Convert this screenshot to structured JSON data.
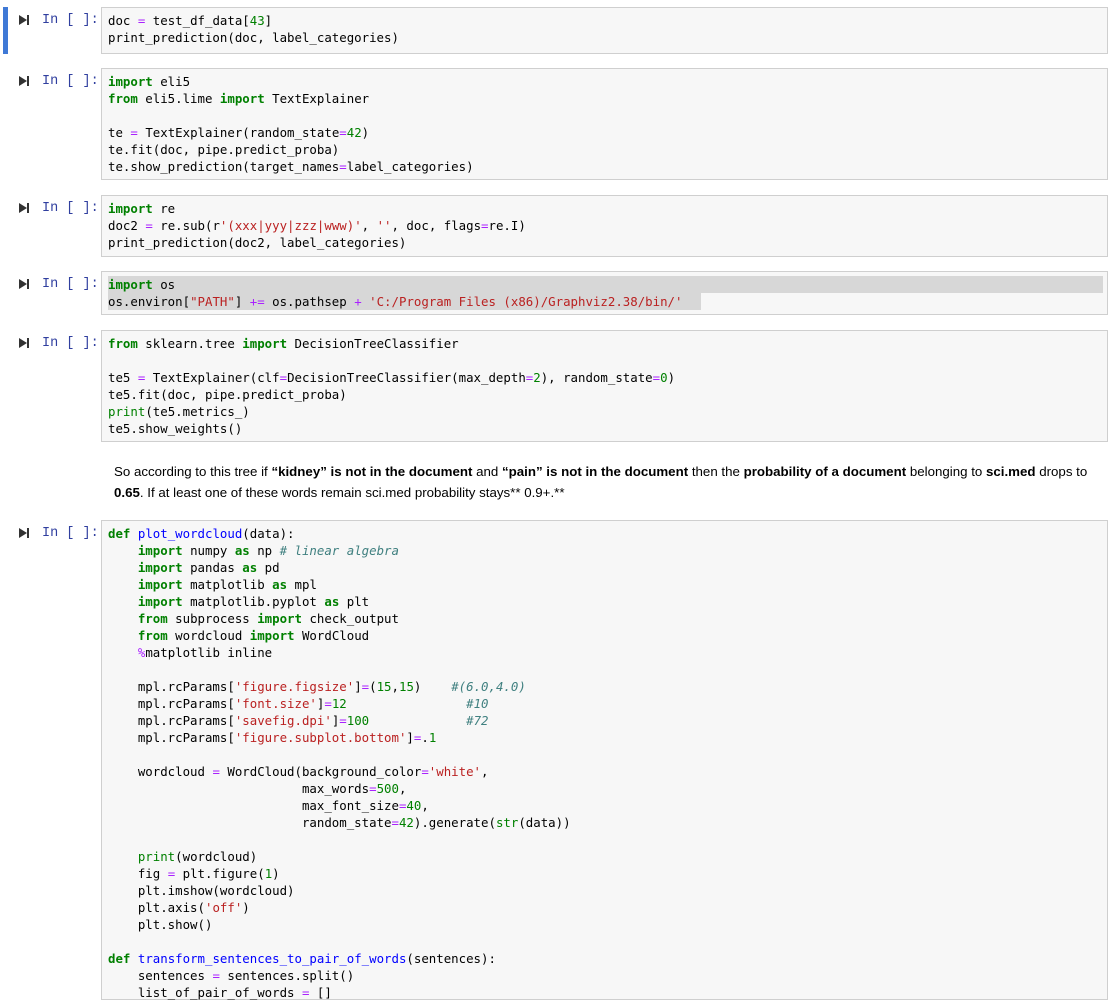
{
  "cells": [
    {
      "prompt": "In [ ]:",
      "lines": [
        [
          [
            "n",
            "doc "
          ],
          [
            "op",
            "="
          ],
          [
            "n",
            " test_df_data["
          ],
          [
            "nu",
            "43"
          ],
          [
            "n",
            "]"
          ]
        ],
        [
          [
            "n",
            "print_prediction(doc, label_categories)"
          ]
        ]
      ]
    },
    {
      "prompt": "In [ ]:",
      "lines": [
        [
          [
            "kw",
            "import"
          ],
          [
            "n",
            " eli5"
          ]
        ],
        [
          [
            "kw",
            "from"
          ],
          [
            "n",
            " eli5.lime "
          ],
          [
            "kw",
            "import"
          ],
          [
            "n",
            " TextExplainer"
          ]
        ],
        [
          [
            "n",
            ""
          ]
        ],
        [
          [
            "n",
            "te "
          ],
          [
            "op",
            "="
          ],
          [
            "n",
            " TextExplainer(random_state"
          ],
          [
            "op",
            "="
          ],
          [
            "nu",
            "42"
          ],
          [
            "n",
            ")"
          ]
        ],
        [
          [
            "n",
            "te.fit(doc, pipe.predict_proba)"
          ]
        ],
        [
          [
            "n",
            "te.show_prediction(target_names"
          ],
          [
            "op",
            "="
          ],
          [
            "n",
            "label_categories)"
          ]
        ]
      ]
    },
    {
      "prompt": "In [ ]:",
      "lines": [
        [
          [
            "kw",
            "import"
          ],
          [
            "n",
            " re"
          ]
        ],
        [
          [
            "n",
            "doc2 "
          ],
          [
            "op",
            "="
          ],
          [
            "n",
            " re.sub(r"
          ],
          [
            "st",
            "'(xxx|yyy|zzz|www)'"
          ],
          [
            "n",
            ", "
          ],
          [
            "st",
            "''"
          ],
          [
            "n",
            ", doc, flags"
          ],
          [
            "op",
            "="
          ],
          [
            "n",
            "re.I)"
          ]
        ],
        [
          [
            "n",
            "print_prediction(doc2, label_categories)"
          ]
        ]
      ]
    },
    {
      "prompt": "In [ ]:",
      "lines": [
        [
          [
            "kw",
            "import"
          ],
          [
            "n",
            " os"
          ]
        ],
        [
          [
            "n",
            "os.environ["
          ],
          [
            "st",
            "\"PATH\""
          ],
          [
            "n",
            "] "
          ],
          [
            "op",
            "+="
          ],
          [
            "n",
            " os.pathsep "
          ],
          [
            "op",
            "+"
          ],
          [
            "n",
            " "
          ],
          [
            "st",
            "'C:/Program Files (x86)/Graphviz2.38/bin/'"
          ]
        ]
      ]
    },
    {
      "prompt": "In [ ]:",
      "lines": [
        [
          [
            "kw",
            "from"
          ],
          [
            "n",
            " sklearn.tree "
          ],
          [
            "kw",
            "import"
          ],
          [
            "n",
            " DecisionTreeClassifier"
          ]
        ],
        [
          [
            "n",
            ""
          ]
        ],
        [
          [
            "n",
            "te5 "
          ],
          [
            "op",
            "="
          ],
          [
            "n",
            " TextExplainer(clf"
          ],
          [
            "op",
            "="
          ],
          [
            "n",
            "DecisionTreeClassifier(max_depth"
          ],
          [
            "op",
            "="
          ],
          [
            "nu",
            "2"
          ],
          [
            "n",
            "), random_state"
          ],
          [
            "op",
            "="
          ],
          [
            "nu",
            "0"
          ],
          [
            "n",
            ")"
          ]
        ],
        [
          [
            "n",
            "te5.fit(doc, pipe.predict_proba)"
          ]
        ],
        [
          [
            "bi",
            "print"
          ],
          [
            "n",
            "(te5.metrics_)"
          ]
        ],
        [
          [
            "n",
            "te5.show_weights()"
          ]
        ]
      ]
    },
    {
      "prompt": "In [ ]:",
      "lines": [
        [
          [
            "kw",
            "def"
          ],
          [
            "n",
            " "
          ],
          [
            "fn",
            "plot_wordcloud"
          ],
          [
            "n",
            "(data):"
          ]
        ],
        [
          [
            "n",
            "    "
          ],
          [
            "kw",
            "import"
          ],
          [
            "n",
            " numpy "
          ],
          [
            "kw",
            "as"
          ],
          [
            "n",
            " np "
          ],
          [
            "cm",
            "# linear algebra"
          ]
        ],
        [
          [
            "n",
            "    "
          ],
          [
            "kw",
            "import"
          ],
          [
            "n",
            " pandas "
          ],
          [
            "kw",
            "as"
          ],
          [
            "n",
            " pd"
          ]
        ],
        [
          [
            "n",
            "    "
          ],
          [
            "kw",
            "import"
          ],
          [
            "n",
            " matplotlib "
          ],
          [
            "kw",
            "as"
          ],
          [
            "n",
            " mpl"
          ]
        ],
        [
          [
            "n",
            "    "
          ],
          [
            "kw",
            "import"
          ],
          [
            "n",
            " matplotlib.pyplot "
          ],
          [
            "kw",
            "as"
          ],
          [
            "n",
            " plt"
          ]
        ],
        [
          [
            "n",
            "    "
          ],
          [
            "kw",
            "from"
          ],
          [
            "n",
            " subprocess "
          ],
          [
            "kw",
            "import"
          ],
          [
            "n",
            " check_output"
          ]
        ],
        [
          [
            "n",
            "    "
          ],
          [
            "kw",
            "from"
          ],
          [
            "n",
            " wordcloud "
          ],
          [
            "kw",
            "import"
          ],
          [
            "n",
            " WordCloud"
          ]
        ],
        [
          [
            "n",
            "    "
          ],
          [
            "mg",
            "%"
          ],
          [
            "n",
            "matplotlib inline"
          ]
        ],
        [
          [
            "n",
            ""
          ]
        ],
        [
          [
            "n",
            "    mpl.rcParams["
          ],
          [
            "st",
            "'figure.figsize'"
          ],
          [
            "n",
            "]"
          ],
          [
            "op",
            "="
          ],
          [
            "n",
            "("
          ],
          [
            "nu",
            "15"
          ],
          [
            "n",
            ","
          ],
          [
            "nu",
            "15"
          ],
          [
            "n",
            ")    "
          ],
          [
            "cm",
            "#(6.0,4.0)"
          ]
        ],
        [
          [
            "n",
            "    mpl.rcParams["
          ],
          [
            "st",
            "'font.size'"
          ],
          [
            "n",
            "]"
          ],
          [
            "op",
            "="
          ],
          [
            "nu",
            "12"
          ],
          [
            "n",
            "                "
          ],
          [
            "cm",
            "#10"
          ]
        ],
        [
          [
            "n",
            "    mpl.rcParams["
          ],
          [
            "st",
            "'savefig.dpi'"
          ],
          [
            "n",
            "]"
          ],
          [
            "op",
            "="
          ],
          [
            "nu",
            "100"
          ],
          [
            "n",
            "             "
          ],
          [
            "cm",
            "#72"
          ]
        ],
        [
          [
            "n",
            "    mpl.rcParams["
          ],
          [
            "st",
            "'figure.subplot.bottom'"
          ],
          [
            "n",
            "]"
          ],
          [
            "op",
            "="
          ],
          [
            "n",
            "."
          ],
          [
            "nu",
            "1"
          ]
        ],
        [
          [
            "n",
            ""
          ]
        ],
        [
          [
            "n",
            "    wordcloud "
          ],
          [
            "op",
            "="
          ],
          [
            "n",
            " WordCloud(background_color"
          ],
          [
            "op",
            "="
          ],
          [
            "st",
            "'white'"
          ],
          [
            "n",
            ","
          ]
        ],
        [
          [
            "n",
            "                          max_words"
          ],
          [
            "op",
            "="
          ],
          [
            "nu",
            "500"
          ],
          [
            "n",
            ","
          ]
        ],
        [
          [
            "n",
            "                          max_font_size"
          ],
          [
            "op",
            "="
          ],
          [
            "nu",
            "40"
          ],
          [
            "n",
            ","
          ]
        ],
        [
          [
            "n",
            "                          random_state"
          ],
          [
            "op",
            "="
          ],
          [
            "nu",
            "42"
          ],
          [
            "n",
            ").generate("
          ],
          [
            "bi",
            "str"
          ],
          [
            "n",
            "(data))"
          ]
        ],
        [
          [
            "n",
            ""
          ]
        ],
        [
          [
            "n",
            "    "
          ],
          [
            "bi",
            "print"
          ],
          [
            "n",
            "(wordcloud)"
          ]
        ],
        [
          [
            "n",
            "    fig "
          ],
          [
            "op",
            "="
          ],
          [
            "n",
            " plt.figure("
          ],
          [
            "nu",
            "1"
          ],
          [
            "n",
            ")"
          ]
        ],
        [
          [
            "n",
            "    plt.imshow(wordcloud)"
          ]
        ],
        [
          [
            "n",
            "    plt.axis("
          ],
          [
            "st",
            "'off'"
          ],
          [
            "n",
            ")"
          ]
        ],
        [
          [
            "n",
            "    plt.show()"
          ]
        ],
        [
          [
            "n",
            ""
          ]
        ],
        [
          [
            "kw",
            "def"
          ],
          [
            "n",
            " "
          ],
          [
            "fn",
            "transform_sentences_to_pair_of_words"
          ],
          [
            "n",
            "(sentences):"
          ]
        ],
        [
          [
            "n",
            "    sentences "
          ],
          [
            "op",
            "="
          ],
          [
            "n",
            " sentences.split()"
          ]
        ],
        [
          [
            "n",
            "    list_of_pair_of_words "
          ],
          [
            "op",
            "="
          ],
          [
            "n",
            " []"
          ]
        ]
      ]
    }
  ],
  "markdown": {
    "t1": "So according to this tree if ",
    "b1": "“kidney” is not in the document",
    "t2": " and ",
    "b2": "“pain” is not in the document",
    "t3": " then the ",
    "b3": "probability of a document",
    "t4": " belonging to ",
    "b4": "sci.med",
    "t5": " drops to ",
    "b5": "0.65",
    "t6": ". If at least one of these words remain sci.med probability stays** 0.9+.**"
  }
}
